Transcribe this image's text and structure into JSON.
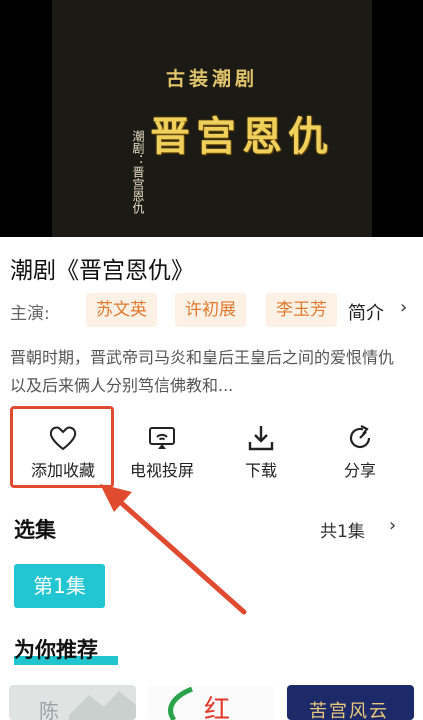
{
  "video": {
    "subtitle": "古装潮剧",
    "title": "晋宫恩仇",
    "side_text": "潮剧：晋宫恩仇"
  },
  "drama": {
    "title": "潮剧《晋宫恩仇》",
    "cast_label": "主演:",
    "actors": [
      "苏文英",
      "许初展",
      "李玉芳"
    ],
    "intro_label": "简介",
    "description": "晋朝时期，晋武帝司马炎和皇后王皇后之间的爱恨情仇以及后来俩人分别笃信佛教和..."
  },
  "actions": [
    {
      "label": "添加收藏",
      "icon": "heart-icon"
    },
    {
      "label": "电视投屏",
      "icon": "cast-screen-icon"
    },
    {
      "label": "下载",
      "icon": "download-icon"
    },
    {
      "label": "分享",
      "icon": "share-icon"
    }
  ],
  "episodes": {
    "title": "选集",
    "count": "共1集",
    "items": [
      "第1集"
    ]
  },
  "recommend": {
    "title": "为你推荐",
    "thumbs": [
      {
        "text": "陈"
      },
      {
        "text": "红"
      },
      {
        "text": "苦宫风云"
      }
    ]
  },
  "colors": {
    "accent": "#22c6d3",
    "tag_text": "#e07a2e",
    "tag_bg": "#fdf1e6",
    "highlight": "#e04a2e"
  }
}
